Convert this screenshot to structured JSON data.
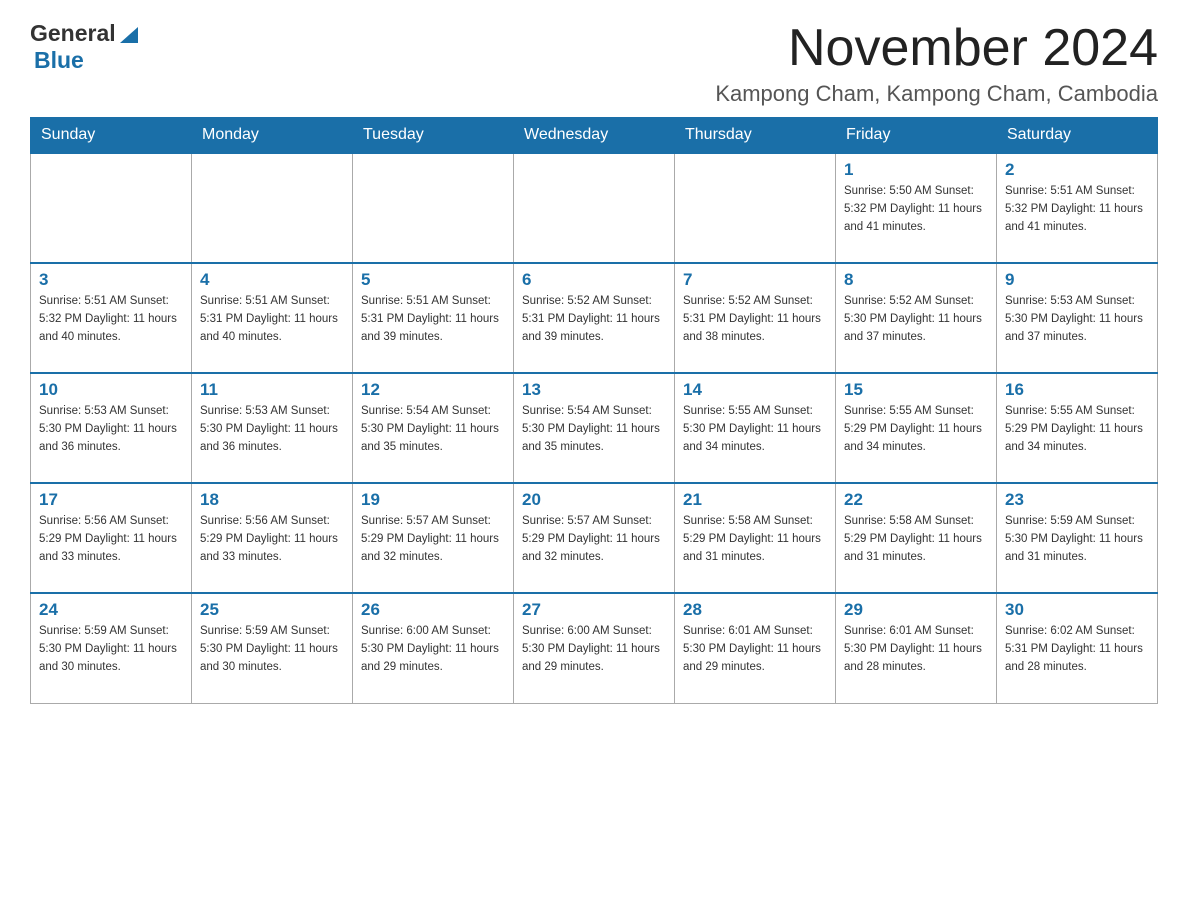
{
  "header": {
    "logo_general": "General",
    "logo_blue": "Blue",
    "month_title": "November 2024",
    "location": "Kampong Cham, Kampong Cham, Cambodia"
  },
  "days_of_week": [
    "Sunday",
    "Monday",
    "Tuesday",
    "Wednesday",
    "Thursday",
    "Friday",
    "Saturday"
  ],
  "weeks": [
    [
      {
        "day": "",
        "info": ""
      },
      {
        "day": "",
        "info": ""
      },
      {
        "day": "",
        "info": ""
      },
      {
        "day": "",
        "info": ""
      },
      {
        "day": "",
        "info": ""
      },
      {
        "day": "1",
        "info": "Sunrise: 5:50 AM\nSunset: 5:32 PM\nDaylight: 11 hours\nand 41 minutes."
      },
      {
        "day": "2",
        "info": "Sunrise: 5:51 AM\nSunset: 5:32 PM\nDaylight: 11 hours\nand 41 minutes."
      }
    ],
    [
      {
        "day": "3",
        "info": "Sunrise: 5:51 AM\nSunset: 5:32 PM\nDaylight: 11 hours\nand 40 minutes."
      },
      {
        "day": "4",
        "info": "Sunrise: 5:51 AM\nSunset: 5:31 PM\nDaylight: 11 hours\nand 40 minutes."
      },
      {
        "day": "5",
        "info": "Sunrise: 5:51 AM\nSunset: 5:31 PM\nDaylight: 11 hours\nand 39 minutes."
      },
      {
        "day": "6",
        "info": "Sunrise: 5:52 AM\nSunset: 5:31 PM\nDaylight: 11 hours\nand 39 minutes."
      },
      {
        "day": "7",
        "info": "Sunrise: 5:52 AM\nSunset: 5:31 PM\nDaylight: 11 hours\nand 38 minutes."
      },
      {
        "day": "8",
        "info": "Sunrise: 5:52 AM\nSunset: 5:30 PM\nDaylight: 11 hours\nand 37 minutes."
      },
      {
        "day": "9",
        "info": "Sunrise: 5:53 AM\nSunset: 5:30 PM\nDaylight: 11 hours\nand 37 minutes."
      }
    ],
    [
      {
        "day": "10",
        "info": "Sunrise: 5:53 AM\nSunset: 5:30 PM\nDaylight: 11 hours\nand 36 minutes."
      },
      {
        "day": "11",
        "info": "Sunrise: 5:53 AM\nSunset: 5:30 PM\nDaylight: 11 hours\nand 36 minutes."
      },
      {
        "day": "12",
        "info": "Sunrise: 5:54 AM\nSunset: 5:30 PM\nDaylight: 11 hours\nand 35 minutes."
      },
      {
        "day": "13",
        "info": "Sunrise: 5:54 AM\nSunset: 5:30 PM\nDaylight: 11 hours\nand 35 minutes."
      },
      {
        "day": "14",
        "info": "Sunrise: 5:55 AM\nSunset: 5:30 PM\nDaylight: 11 hours\nand 34 minutes."
      },
      {
        "day": "15",
        "info": "Sunrise: 5:55 AM\nSunset: 5:29 PM\nDaylight: 11 hours\nand 34 minutes."
      },
      {
        "day": "16",
        "info": "Sunrise: 5:55 AM\nSunset: 5:29 PM\nDaylight: 11 hours\nand 34 minutes."
      }
    ],
    [
      {
        "day": "17",
        "info": "Sunrise: 5:56 AM\nSunset: 5:29 PM\nDaylight: 11 hours\nand 33 minutes."
      },
      {
        "day": "18",
        "info": "Sunrise: 5:56 AM\nSunset: 5:29 PM\nDaylight: 11 hours\nand 33 minutes."
      },
      {
        "day": "19",
        "info": "Sunrise: 5:57 AM\nSunset: 5:29 PM\nDaylight: 11 hours\nand 32 minutes."
      },
      {
        "day": "20",
        "info": "Sunrise: 5:57 AM\nSunset: 5:29 PM\nDaylight: 11 hours\nand 32 minutes."
      },
      {
        "day": "21",
        "info": "Sunrise: 5:58 AM\nSunset: 5:29 PM\nDaylight: 11 hours\nand 31 minutes."
      },
      {
        "day": "22",
        "info": "Sunrise: 5:58 AM\nSunset: 5:29 PM\nDaylight: 11 hours\nand 31 minutes."
      },
      {
        "day": "23",
        "info": "Sunrise: 5:59 AM\nSunset: 5:30 PM\nDaylight: 11 hours\nand 31 minutes."
      }
    ],
    [
      {
        "day": "24",
        "info": "Sunrise: 5:59 AM\nSunset: 5:30 PM\nDaylight: 11 hours\nand 30 minutes."
      },
      {
        "day": "25",
        "info": "Sunrise: 5:59 AM\nSunset: 5:30 PM\nDaylight: 11 hours\nand 30 minutes."
      },
      {
        "day": "26",
        "info": "Sunrise: 6:00 AM\nSunset: 5:30 PM\nDaylight: 11 hours\nand 29 minutes."
      },
      {
        "day": "27",
        "info": "Sunrise: 6:00 AM\nSunset: 5:30 PM\nDaylight: 11 hours\nand 29 minutes."
      },
      {
        "day": "28",
        "info": "Sunrise: 6:01 AM\nSunset: 5:30 PM\nDaylight: 11 hours\nand 29 minutes."
      },
      {
        "day": "29",
        "info": "Sunrise: 6:01 AM\nSunset: 5:30 PM\nDaylight: 11 hours\nand 28 minutes."
      },
      {
        "day": "30",
        "info": "Sunrise: 6:02 AM\nSunset: 5:31 PM\nDaylight: 11 hours\nand 28 minutes."
      }
    ]
  ]
}
